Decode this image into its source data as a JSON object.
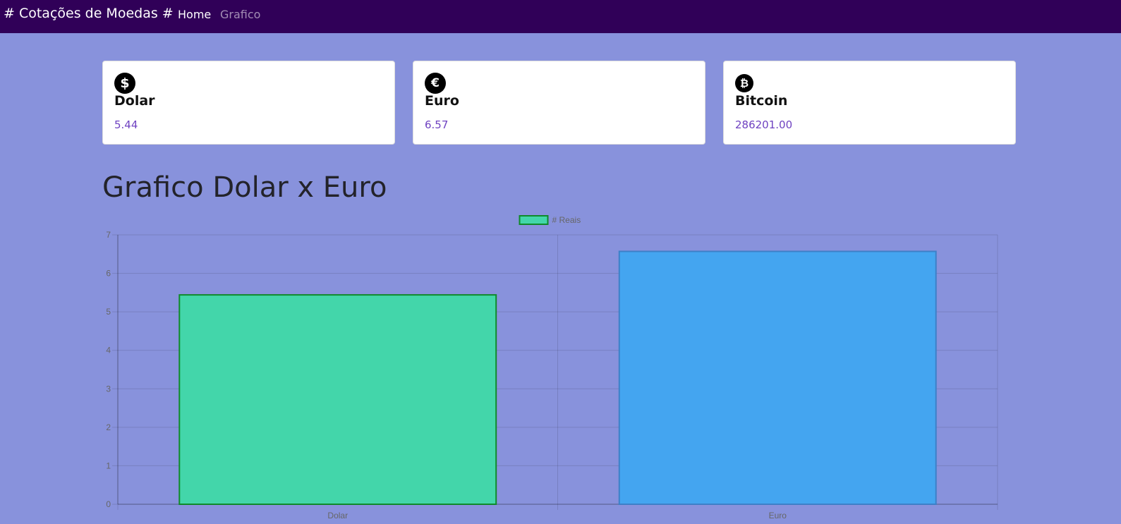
{
  "navbar": {
    "brand": "# Cotações de Moedas #",
    "links": [
      {
        "label": "Home"
      },
      {
        "label": "Grafico"
      }
    ]
  },
  "cards": [
    {
      "icon": "dollar-icon",
      "glyph": "$",
      "title": "Dolar",
      "value": "5.44"
    },
    {
      "icon": "euro-icon",
      "glyph": "€",
      "title": "Euro",
      "value": "6.57"
    },
    {
      "icon": "bitcoin-icon",
      "glyph": "₿",
      "title": "Bitcoin",
      "value": "286201.00"
    }
  ],
  "page_title": "Grafico Dolar x Euro",
  "chart_data": {
    "type": "bar",
    "categories": [
      "Dolar",
      "Euro"
    ],
    "series": [
      {
        "name": "# Reais",
        "values": [
          5.44,
          6.57
        ]
      }
    ],
    "bar_colors": [
      "#43d6aa",
      "#44a5f0"
    ],
    "bar_border_colors": [
      "#0f8a2a",
      "#3d80c8"
    ],
    "ylim": [
      0,
      7
    ],
    "yticks": [
      "0",
      "1",
      "2",
      "3",
      "4",
      "5",
      "6",
      "7"
    ],
    "legend_position": "top",
    "grid": true
  }
}
